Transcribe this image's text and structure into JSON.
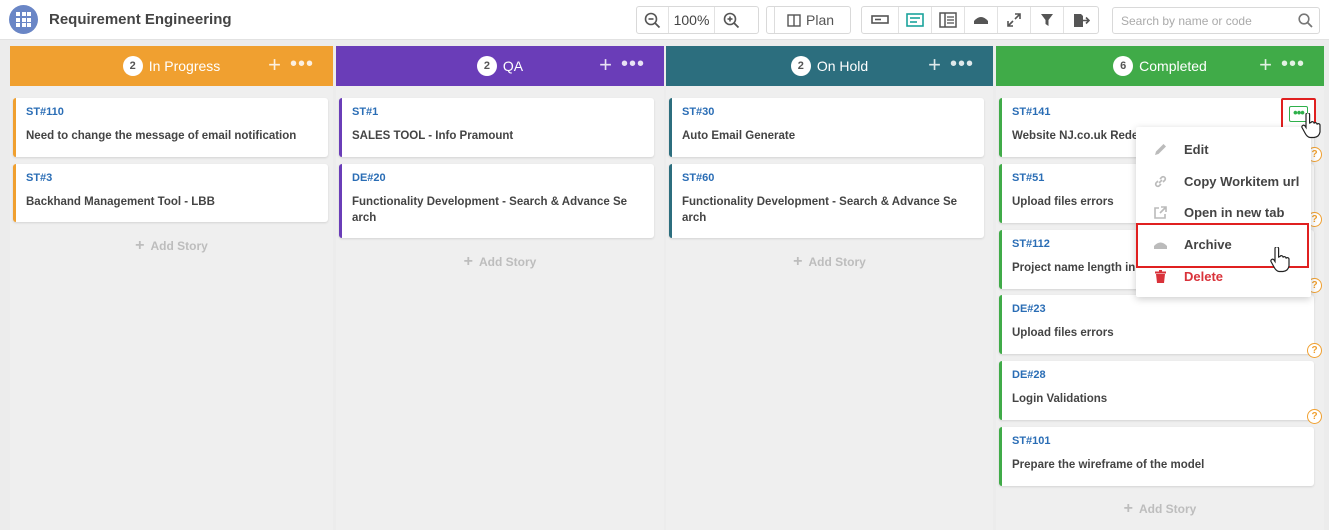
{
  "app": {
    "title": "Requirement Engineering"
  },
  "toolbar": {
    "zoom_value": "100%",
    "plan_label": "Plan",
    "search_placeholder": "Search by name or code"
  },
  "colors": {
    "in_progress": "#f0a030",
    "qa": "#6a3db8",
    "on_hold": "#2c6e7e",
    "completed": "#40ab48",
    "card_id": "#2a6db5",
    "highlight": "#e02020"
  },
  "columns": [
    {
      "title": "In Progress",
      "count": "2",
      "cards": [
        {
          "id": "ST#110",
          "title": "Need to change the message of email notification"
        },
        {
          "id": "ST#3",
          "title": "Backhand Management Tool - LBB"
        }
      ],
      "add_label": "Add Story"
    },
    {
      "title": "QA",
      "count": "2",
      "cards": [
        {
          "id": "ST#1",
          "title": "SALES TOOL - Info Pramount"
        },
        {
          "id": "DE#20",
          "title": "Functionality Development - Search & Advance Se arch"
        }
      ],
      "add_label": "Add Story"
    },
    {
      "title": "On Hold",
      "count": "2",
      "cards": [
        {
          "id": "ST#30",
          "title": "Auto Email Generate"
        },
        {
          "id": "ST#60",
          "title": "Functionality Development - Search & Advance Se arch"
        }
      ],
      "add_label": "Add Story"
    },
    {
      "title": "Completed",
      "count": "6",
      "cards": [
        {
          "id": "ST#141",
          "title": "Website NJ.co.uk Rede"
        },
        {
          "id": "ST#51",
          "title": "Upload files errors"
        },
        {
          "id": "ST#112",
          "title": "Project name length in"
        },
        {
          "id": "DE#23",
          "title": "Upload files errors"
        },
        {
          "id": "DE#28",
          "title": "Login Validations"
        },
        {
          "id": "ST#101",
          "title": "Prepare the wireframe of the model"
        }
      ],
      "add_label": "Add Story"
    }
  ],
  "context_menu": {
    "items": [
      {
        "label": "Edit",
        "icon": "pencil-icon"
      },
      {
        "label": "Copy Workitem url",
        "icon": "link-icon"
      },
      {
        "label": "Open in new tab",
        "icon": "external-link-icon"
      },
      {
        "label": "Archive",
        "icon": "archive-icon"
      },
      {
        "label": "Delete",
        "icon": "trash-icon"
      }
    ]
  }
}
